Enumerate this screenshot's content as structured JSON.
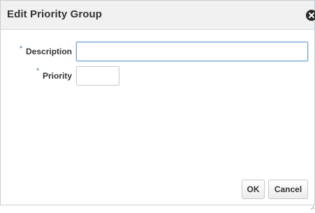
{
  "dialog": {
    "title": "Edit Priority Group",
    "close_icon": "close-circle-icon"
  },
  "form": {
    "required_marker": "*",
    "description": {
      "label": "Description",
      "value": "",
      "placeholder": ""
    },
    "priority": {
      "label": "Priority",
      "value": "",
      "placeholder": ""
    }
  },
  "footer": {
    "ok_label": "OK",
    "cancel_label": "Cancel"
  }
}
